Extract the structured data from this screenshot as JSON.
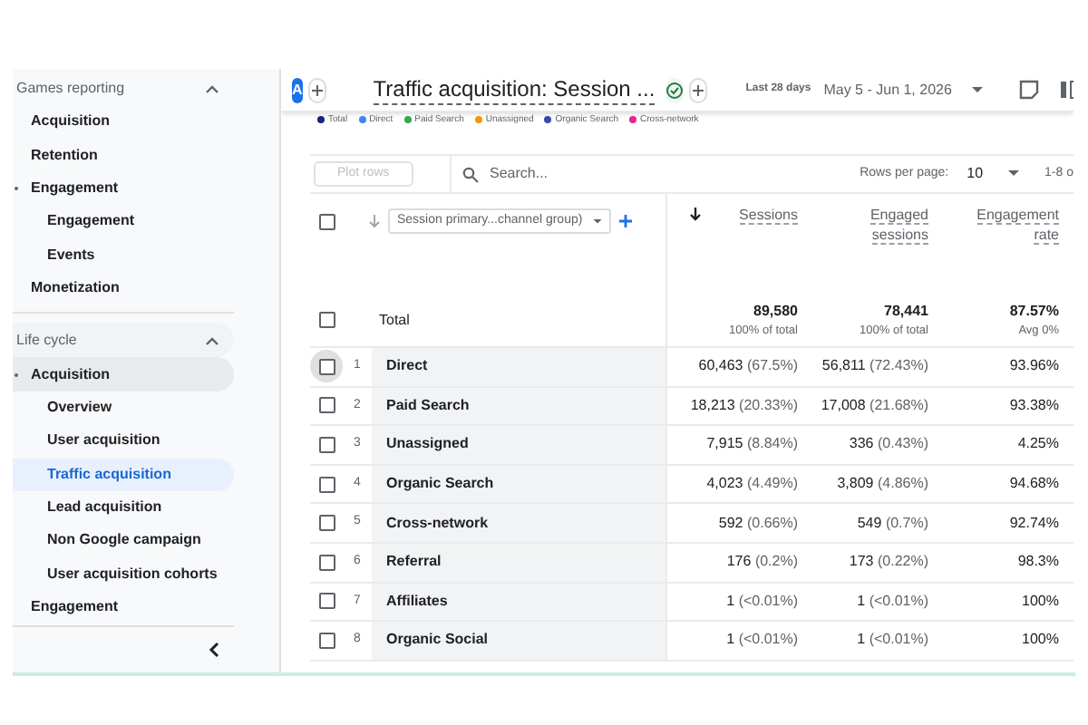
{
  "sidebar": {
    "sections": [
      {
        "title": "Games reporting",
        "expanded": true,
        "items": [
          {
            "label": "Acquisition",
            "selected": false
          },
          {
            "label": "Retention",
            "selected": false
          },
          {
            "label": "Engagement",
            "selected": false,
            "children": [
              {
                "label": "Engagement",
                "selected": false
              },
              {
                "label": "Events",
                "selected": false
              }
            ]
          },
          {
            "label": "Monetization",
            "selected": false
          }
        ]
      },
      {
        "title": "Life cycle",
        "expanded": true,
        "items": [
          {
            "label": "Acquisition",
            "selected": false,
            "children": [
              {
                "label": "Overview",
                "selected": false
              },
              {
                "label": "User acquisition",
                "selected": false
              },
              {
                "label": "Traffic acquisition",
                "selected": true
              },
              {
                "label": "Lead acquisition",
                "selected": false
              },
              {
                "label": "Non Google campaign",
                "selected": false
              },
              {
                "label": "User acquisition cohorts",
                "selected": false
              }
            ]
          },
          {
            "label": "Engagement",
            "selected": false
          }
        ]
      }
    ]
  },
  "header": {
    "avatar": "A",
    "title": "Traffic acquisition: Session ...",
    "range_label": "Last 28 days",
    "date_range": "May 5 - Jun 1, 2026"
  },
  "legend": [
    {
      "label": "Total",
      "color": "#1a237e"
    },
    {
      "label": "Direct",
      "color": "#4285f4"
    },
    {
      "label": "Paid Search",
      "color": "#34a853"
    },
    {
      "label": "Unassigned",
      "color": "#f29900"
    },
    {
      "label": "Organic Search",
      "color": "#3949ab"
    },
    {
      "label": "Cross-network",
      "color": "#e52592"
    }
  ],
  "table": {
    "plot_rows": "Plot rows",
    "search": {
      "placeholder": "Search..."
    },
    "rows_per_page_label": "Rows per page:",
    "rows_per_page": "10",
    "pagination": "1-8 o",
    "select_all": {
      "checked": false
    },
    "dimension": "Session primary...channel group)",
    "columns": [
      {
        "label": "Sessions",
        "sorted": true
      },
      {
        "label": "Engaged sessions",
        "sorted": false
      },
      {
        "label": "Engagement rate",
        "sorted": false
      }
    ],
    "total": {
      "label": "Total",
      "checked": false,
      "values": [
        {
          "value": "89,580",
          "sub": "100% of total"
        },
        {
          "value": "78,441",
          "sub": "100% of total"
        },
        {
          "value": "87.57%",
          "sub": "Avg 0%"
        }
      ]
    },
    "rows": [
      {
        "index": "1",
        "name": "Direct",
        "checked": false,
        "cells": [
          {
            "value": "60,463",
            "share": "(67.5%)"
          },
          {
            "value": "56,811",
            "share": "(72.43%)"
          },
          {
            "value": "93.96%"
          }
        ]
      },
      {
        "index": "2",
        "name": "Paid Search",
        "checked": false,
        "cells": [
          {
            "value": "18,213",
            "share": "(20.33%)"
          },
          {
            "value": "17,008",
            "share": "(21.68%)"
          },
          {
            "value": "93.38%"
          }
        ]
      },
      {
        "index": "3",
        "name": "Unassigned",
        "checked": false,
        "cells": [
          {
            "value": "7,915",
            "share": "(8.84%)"
          },
          {
            "value": "336",
            "share": "(0.43%)"
          },
          {
            "value": "4.25%"
          }
        ]
      },
      {
        "index": "4",
        "name": "Organic Search",
        "checked": false,
        "cells": [
          {
            "value": "4,023",
            "share": "(4.49%)"
          },
          {
            "value": "3,809",
            "share": "(4.86%)"
          },
          {
            "value": "94.68%"
          }
        ]
      },
      {
        "index": "5",
        "name": "Cross-network",
        "checked": false,
        "cells": [
          {
            "value": "592",
            "share": "(0.66%)"
          },
          {
            "value": "549",
            "share": "(0.7%)"
          },
          {
            "value": "92.74%"
          }
        ]
      },
      {
        "index": "6",
        "name": "Referral",
        "checked": false,
        "cells": [
          {
            "value": "176",
            "share": "(0.2%)"
          },
          {
            "value": "173",
            "share": "(0.22%)"
          },
          {
            "value": "98.3%"
          }
        ]
      },
      {
        "index": "7",
        "name": "Affiliates",
        "checked": false,
        "cells": [
          {
            "value": "1",
            "share": "(<0.01%)"
          },
          {
            "value": "1",
            "share": "(<0.01%)"
          },
          {
            "value": "100%"
          }
        ]
      },
      {
        "index": "8",
        "name": "Organic Social",
        "checked": false,
        "cells": [
          {
            "value": "1",
            "share": "(<0.01%)"
          },
          {
            "value": "1",
            "share": "(<0.01%)"
          },
          {
            "value": "100%"
          }
        ]
      }
    ]
  }
}
